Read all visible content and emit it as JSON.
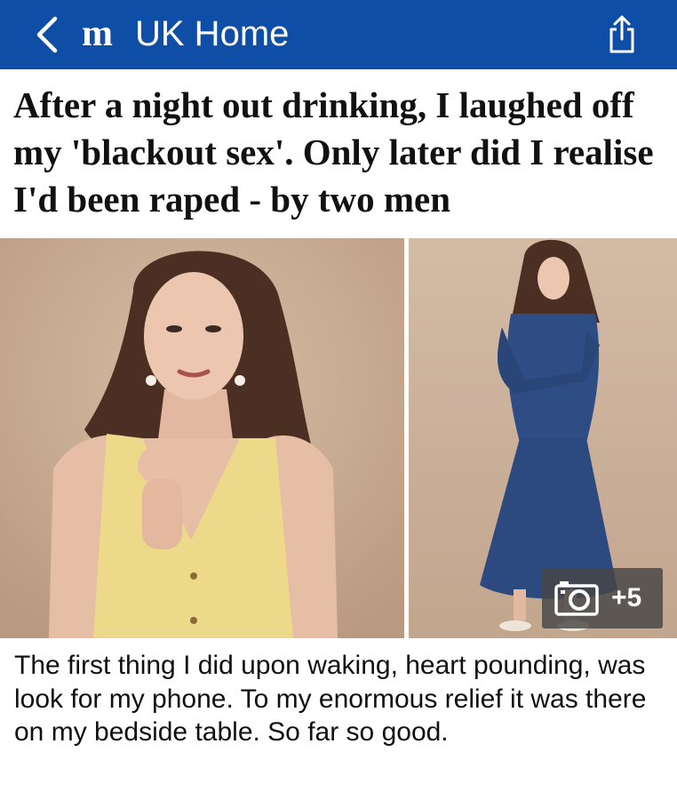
{
  "header": {
    "logo_text": "m",
    "home_label": "UK Home",
    "back_icon": "chevron-left-icon",
    "share_icon": "share-icon",
    "bar_color": "#0f4ea6"
  },
  "article": {
    "headline": "After a night out drinking, I laughed off my 'blackout sex'. Only later did I realise I'd been raped - by two men",
    "gallery": {
      "photo_count_badge": "+5",
      "badge_icon": "camera-icon",
      "photos": [
        "portrait-yellow-top",
        "portrait-blue-dress"
      ]
    },
    "excerpt": "The first thing I did upon waking, heart pounding, was look for my phone. To my enormous relief it was there on my bedside table. So far so good."
  }
}
